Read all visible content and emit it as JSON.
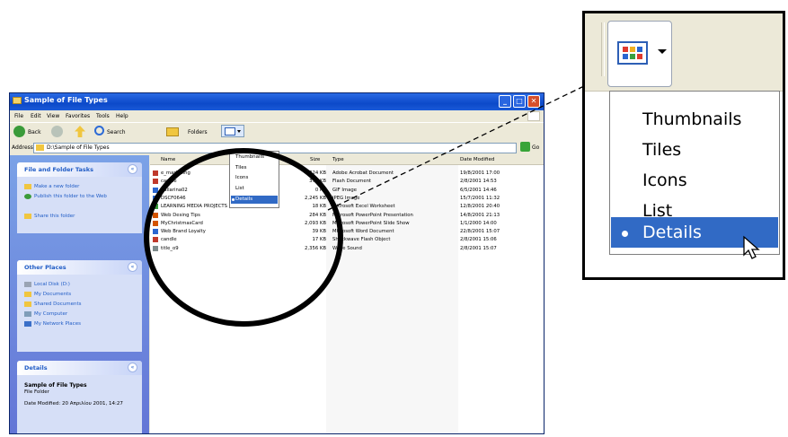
{
  "window": {
    "title": "Sample of File Types",
    "menu": [
      "File",
      "Edit",
      "View",
      "Favorites",
      "Tools",
      "Help"
    ],
    "toolbar": {
      "back": "Back",
      "search": "Search",
      "folders": "Folders"
    },
    "address": {
      "label": "Address",
      "value": "D:\\Sample of File Types",
      "go": "Go"
    }
  },
  "left_panes": {
    "file_tasks": {
      "title": "File and Folder Tasks",
      "items": [
        "Make a new folder",
        "Publish this folder to the Web",
        "Share this folder"
      ]
    },
    "other_places": {
      "title": "Other Places",
      "items": [
        "Local Disk (D:)",
        "My Documents",
        "Shared Documents",
        "My Computer",
        "My Network Places"
      ]
    },
    "details": {
      "title": "Details",
      "name": "Sample of File Types",
      "type": "File Folder",
      "modified": "Date Modified: 20 Απριλίου 2001, 14:27"
    }
  },
  "columns": {
    "name": "Name",
    "size": "Size",
    "type": "Type",
    "date": "Date Modified"
  },
  "files": [
    {
      "name": "e_marketing",
      "size": "324 KB",
      "type": "Adobe Acrobat Document",
      "date": "19/8/2001 17:00"
    },
    {
      "name": "candle",
      "size": "372 KB",
      "type": "Flash Document",
      "date": "2/8/2001 14:53"
    },
    {
      "name": "ballarina02",
      "size": "0 KB",
      "type": "GIF Image",
      "date": "6/5/2001 14:46"
    },
    {
      "name": "DSCF0646",
      "size": "2,245 KB",
      "type": "JPEG Image",
      "date": "15/7/2001 11:32"
    },
    {
      "name": "LEARNING MEDIA PROJECTS",
      "size": "18 KB",
      "type": "Microsoft Excel Worksheet",
      "date": "12/8/2001 20:40"
    },
    {
      "name": "Web Desing Tips",
      "size": "284 KB",
      "type": "Microsoft PowerPoint Presentation",
      "date": "14/8/2001 21:13"
    },
    {
      "name": "MyChristmasCard",
      "size": "2,093 KB",
      "type": "Microsoft PowerPoint Slide Show",
      "date": "1/1/2000 14:00"
    },
    {
      "name": "Web Brand Loyalty",
      "size": "39 KB",
      "type": "Microsoft Word Document",
      "date": "22/8/2001 15:07"
    },
    {
      "name": "candle",
      "size": "17 KB",
      "type": "Shockwave Flash Object",
      "date": "2/8/2001 15:06"
    },
    {
      "name": "title_o9",
      "size": "2,356 KB",
      "type": "Wave Sound",
      "date": "2/8/2001 15:07"
    }
  ],
  "view_menu_small": {
    "items": [
      "Thumbnails",
      "Tiles",
      "Icons",
      "List",
      "Details"
    ],
    "selected": "Details"
  },
  "view_menu_zoom": {
    "items": [
      "Thumbnails",
      "Tiles",
      "Icons",
      "List",
      "Details"
    ],
    "selected": "Details"
  },
  "colors": {
    "title_blue": "#0c49c9",
    "task_pane": "#7ba2e7",
    "selection": "#316ac5"
  }
}
